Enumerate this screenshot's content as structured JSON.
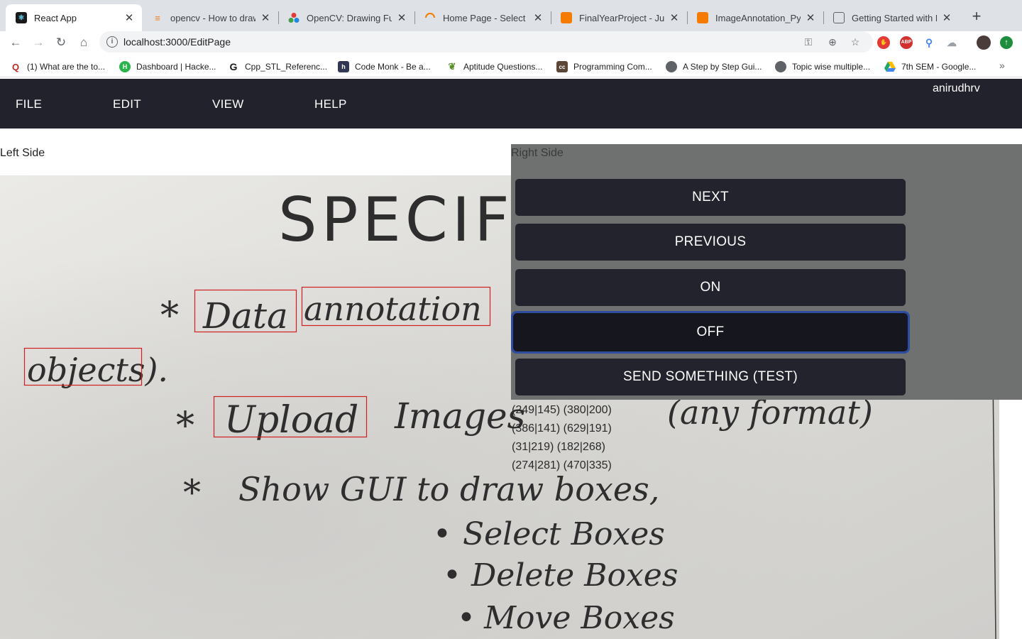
{
  "browser": {
    "tabs": [
      {
        "title": "React App",
        "icon": "react-icon",
        "color": "#1a1a1a",
        "active": true
      },
      {
        "title": "opencv - How to draw a",
        "icon": "stackoverflow-icon",
        "color": "#f48024"
      },
      {
        "title": "OpenCV: Drawing Func",
        "icon": "opencv-icon",
        "color": "#5f6368"
      },
      {
        "title": "Home Page - Select or c",
        "icon": "loading-icon",
        "color": "#f57c00"
      },
      {
        "title": "FinalYearProject - Jupyt",
        "icon": "jupyter-icon",
        "color": "#f57c00"
      },
      {
        "title": "ImageAnnotation_Pytho",
        "icon": "jupyter-icon",
        "color": "#f57c00"
      },
      {
        "title": "Getting Started with Im",
        "icon": "docs-icon",
        "color": "#5f6368"
      }
    ],
    "new_tab_symbol": "+",
    "url": "localhost:3000/EditPage",
    "bookmarks": [
      {
        "label": "(1) What are the to...",
        "icon": "quora-icon",
        "color": "#b92b27"
      },
      {
        "label": "Dashboard | Hacke...",
        "icon": "hackerearth-icon",
        "color": "#2bb24c"
      },
      {
        "label": "Cpp_STL_Referenc...",
        "icon": "github-icon",
        "color": "#1a1a1a"
      },
      {
        "label": "Code Monk - Be a...",
        "icon": "hackerearth-icon",
        "color": "#323754"
      },
      {
        "label": "Aptitude Questions...",
        "icon": "leaf-icon",
        "color": "#5a8f29"
      },
      {
        "label": "Programming Com...",
        "icon": "codechef-icon",
        "color": "#5b4638"
      },
      {
        "label": "A Step by Step Gui...",
        "icon": "globe-icon",
        "color": "#5f6368"
      },
      {
        "label": "Topic wise multiple...",
        "icon": "globe-icon",
        "color": "#5f6368"
      },
      {
        "label": "7th SEM - Google...",
        "icon": "drive-icon",
        "color": "#1fa463"
      }
    ]
  },
  "app": {
    "menu": [
      "FILE",
      "EDIT",
      "VIEW",
      "HELP"
    ],
    "username": "anirudhrv",
    "left_label": "Left Side",
    "right_label": "Right Side",
    "buttons": [
      "NEXT",
      "PREVIOUS",
      "ON",
      "OFF",
      "SEND SOMETHING (TEST)"
    ],
    "focused_button": "OFF",
    "coordinates": [
      "(249|145) (380|200)",
      "(386|141) (629|191)",
      "(31|219) (182|268)",
      "(274|281) (470|335)"
    ],
    "image_text": {
      "heading": "SPECIFI",
      "line1_a": "Data",
      "line1_b": "annotation",
      "line2": "objects).",
      "line3_a": "Upload",
      "line3_b": "Images",
      "line3_c": "(any format)",
      "line4": "Show GUI to draw boxes,",
      "bullet1": "Select Boxes",
      "bullet2": "Delete Boxes",
      "bullet3": "Move Boxes"
    },
    "colors": {
      "appbar": "#22222c",
      "panel": "#6f7070",
      "button": "#23232d",
      "box_stroke": "#d22020"
    }
  }
}
